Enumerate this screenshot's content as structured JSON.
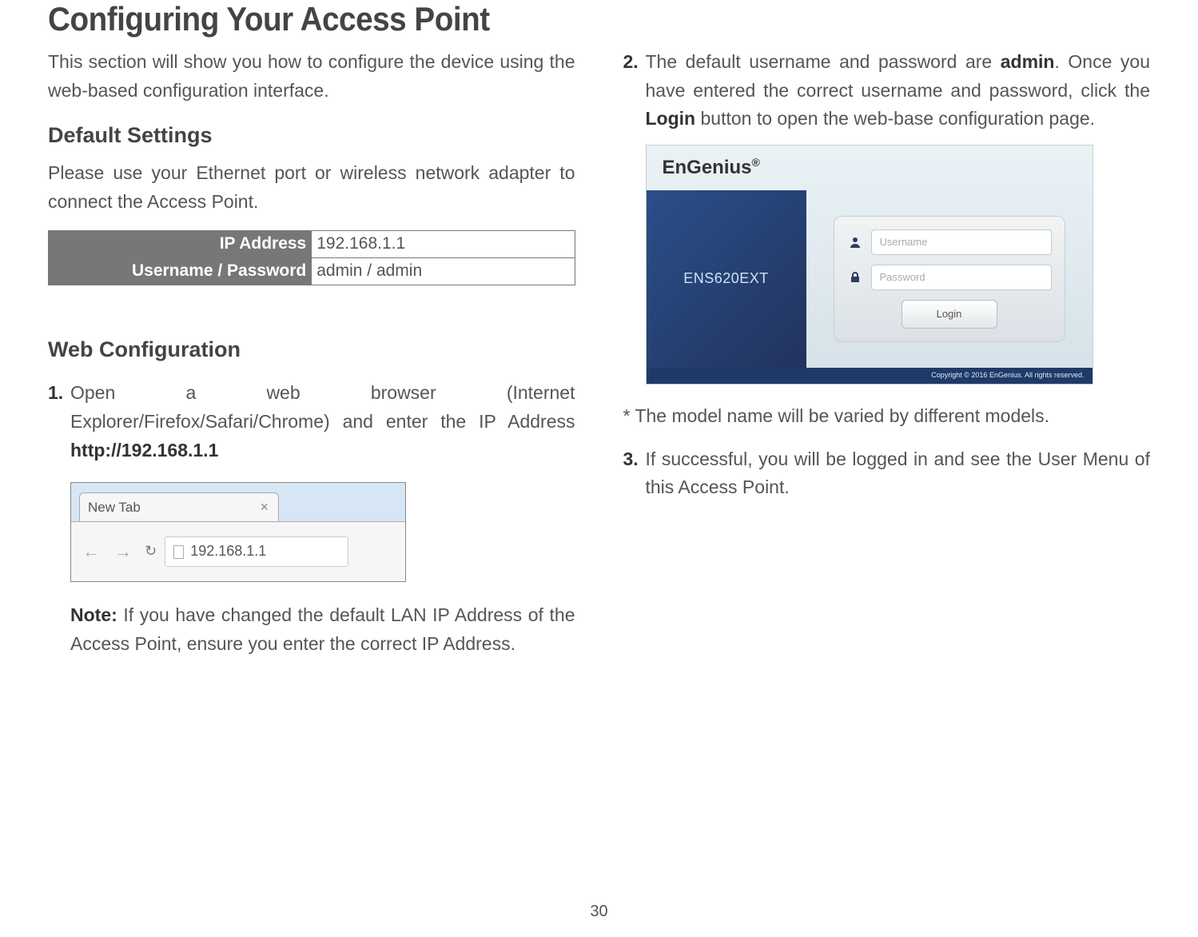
{
  "page": {
    "title": "Configuring Your Access Point",
    "intro": "This section will show you how to configure the device using the web-based configuration interface.",
    "page_number": "30"
  },
  "default_settings": {
    "heading": "Default Settings",
    "instruction": "Please use your Ethernet port or wireless network adapter to connect the Access Point.",
    "rows": [
      {
        "label": "IP Address",
        "value": "192.168.1.1"
      },
      {
        "label": "Username / Password",
        "value": "admin / admin"
      }
    ]
  },
  "webconfig": {
    "heading": "Web Configuration",
    "step1_num": "1.",
    "step1_text_a": "Open a web browser (Internet Explorer/Firefox/Safari/Chrome) and enter the IP Address ",
    "step1_text_b": "http://192.168.1.1",
    "note_label": "Note:",
    "note_text": " If you have changed the default LAN IP Address of the Access Point, ensure you enter the correct IP Address."
  },
  "browser": {
    "tab_label": "New Tab",
    "close": "×",
    "nav": "←  →",
    "reload": "↻",
    "address": "192.168.1.1"
  },
  "right": {
    "step2_num": "2.",
    "step2_a": "The default username and password are ",
    "step2_b": "admin",
    "step2_c": ". Once you have entered the correct username and password, click the ",
    "step2_d": "Login",
    "step2_e": " button to open the web-base configuration page.",
    "model_note": "* The model name will be varied by different models.",
    "step3_num": "3.",
    "step3_text": "If successful, you will be logged in and see the User Menu of this Access Point."
  },
  "login": {
    "brand": "EnGenius",
    "brand_symbol_reg": "®",
    "model": "ENS620EXT",
    "username_placeholder": "Username",
    "password_placeholder": "Password",
    "button": "Login",
    "footer": "Copyright © 2016 EnGenius. All rights reserved."
  }
}
